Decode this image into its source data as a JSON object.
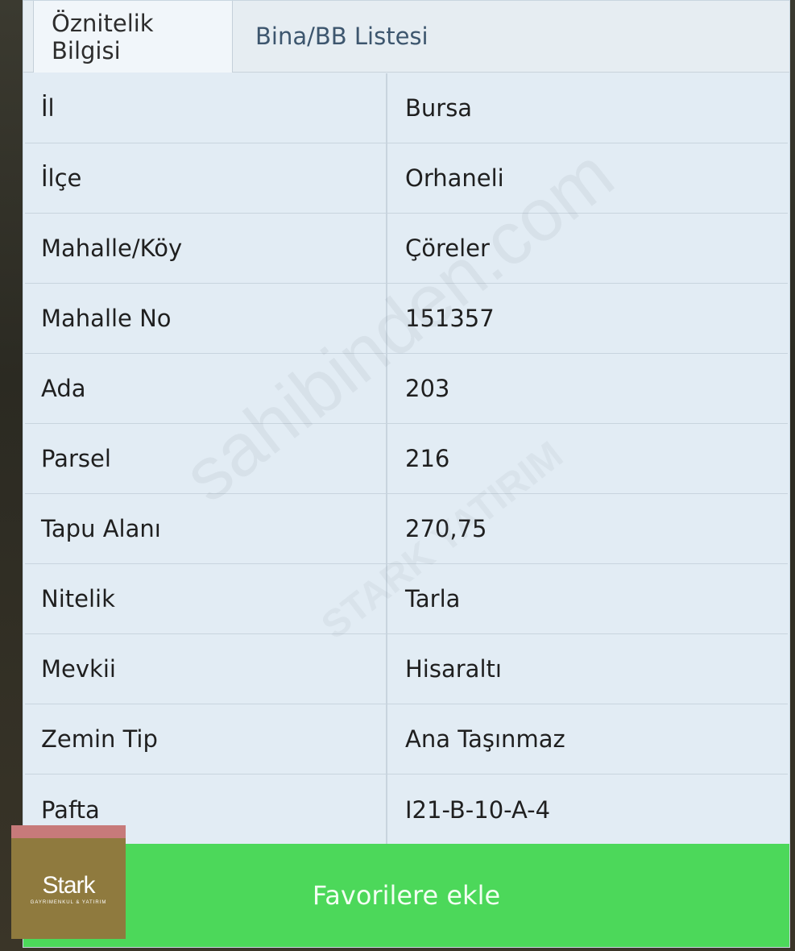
{
  "tabs": [
    {
      "label": "Öznitelik Bilgisi",
      "active": true
    },
    {
      "label": "Bina/BB Listesi",
      "active": false
    }
  ],
  "attributes": [
    {
      "label": "İl",
      "value": "Bursa"
    },
    {
      "label": "İlçe",
      "value": "Orhaneli"
    },
    {
      "label": "Mahalle/Köy",
      "value": "Çöreler"
    },
    {
      "label": "Mahalle No",
      "value": "151357"
    },
    {
      "label": "Ada",
      "value": "203"
    },
    {
      "label": "Parsel",
      "value": "216"
    },
    {
      "label": "Tapu Alanı",
      "value": "270,75"
    },
    {
      "label": "Nitelik",
      "value": "Tarla"
    },
    {
      "label": "Mevkii",
      "value": "Hisaraltı"
    },
    {
      "label": "Zemin Tip",
      "value": "Ana Taşınmaz"
    },
    {
      "label": "Pafta",
      "value": "I21-B-10-A-4"
    }
  ],
  "favorite_button": {
    "label": "Favorilere ekle"
  },
  "logo": {
    "name": "Stark",
    "tagline": "GAYRIMENKUL & YATIRIM"
  },
  "watermark": {
    "text": "sahibinden.com",
    "text2": "STARK YATIRIM"
  },
  "colors": {
    "accent_green": "#4cd85a",
    "panel_bg": "#e2ecf4",
    "logo_bg": "#8f7a3e"
  }
}
